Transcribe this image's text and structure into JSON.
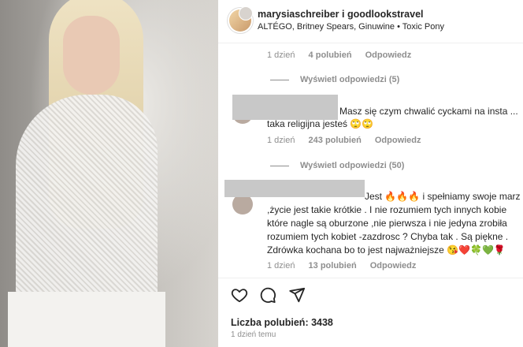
{
  "post": {
    "username_line": "marysiaschreiber i goodlookstravel",
    "audio_line": "ALTÉGO, Britney Spears, Ginuwine • Toxic Pony"
  },
  "comments": [
    {
      "meta": {
        "age": "1 dzień",
        "likes": "4 polubień",
        "reply": "Odpowiedz"
      },
      "view_replies": "Wyświetl odpowiedzi (5)"
    },
    {
      "lines": [
        "Masz się czym chwalić cyckami na insta ...",
        "taka religijna jesteś 🙄🙄"
      ],
      "meta": {
        "age": "1 dzień",
        "likes": "243 polubień",
        "reply": "Odpowiedz"
      },
      "view_replies": "Wyświetl odpowiedzi (50)"
    },
    {
      "lines": [
        "Jest 🔥🔥🔥 i spełniamy swoje marz",
        ",życie jest takie krótkie . I nie rozumiem tych innych kobie",
        "które nagle są oburzone ,nie pierwsza i nie jedyna zrobiła",
        "rozumiem tych kobiet -zazdrosc ? Chyba tak . Są piękne .",
        "Zdrówka kochana bo to jest najważniejsze 😘❤️🍀💚🌹"
      ],
      "meta": {
        "age": "1 dzień",
        "likes": "13 polubień",
        "reply": "Odpowiedz"
      }
    }
  ],
  "footer": {
    "likes_text": "Liczba polubień: 3438",
    "time_text": "1 dzień temu"
  },
  "icons": [
    "heart-icon",
    "comment-icon",
    "share-icon"
  ]
}
